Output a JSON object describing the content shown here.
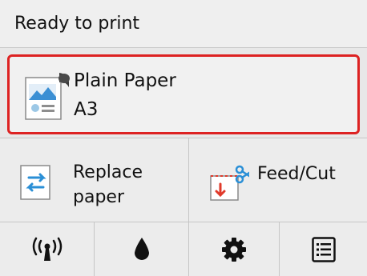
{
  "status": {
    "text": "Ready to print"
  },
  "paper": {
    "type": "Plain Paper",
    "size": "A3"
  },
  "actions": {
    "replace": {
      "line1": "Replace",
      "line2": "paper"
    },
    "feed": {
      "label": "Feed/Cut"
    }
  },
  "icons": {
    "paper": "paper-settings-icon",
    "replace": "replace-paper-icon",
    "feed": "feed-cut-icon",
    "nav": [
      "wireless-icon",
      "ink-drop-icon",
      "gear-icon",
      "list-icon"
    ]
  },
  "colors": {
    "highlight": "#dd2222",
    "icon_blue": "#2a8fd6",
    "icon_red": "#e03a2a"
  }
}
